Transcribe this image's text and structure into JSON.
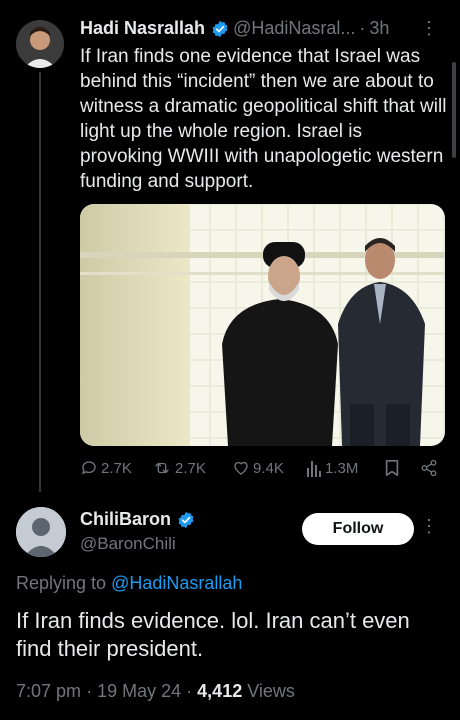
{
  "tweet": {
    "author_name": "Hadi Nasrallah",
    "handle": "@HadiNasral...",
    "separator": "·",
    "time": "3h",
    "text": "If Iran finds one evidence that Israel was behind this “incident” then we are about to witness a dramatic geopolitical shift that will light up the whole region. Israel is provoking WWIII with unapologetic western funding and support.",
    "image_icon": "photo-two-men",
    "actions": {
      "replies": "2.7K",
      "reposts": "2.7K",
      "likes": "9.4K",
      "views": "1.3M"
    }
  },
  "reply": {
    "author_name": "ChiliBaron",
    "handle": "@BaronChili",
    "follow_label": "Follow",
    "replying_prefix": "Replying to ",
    "replying_to": "@HadiNasrallah",
    "text": "If Iran finds evidence. lol. Iran can’t even find their president.",
    "time": "7:07 pm",
    "dot1": "·",
    "date": "19 May 24",
    "dot2": "·",
    "views_count": "4,412",
    "views_label": "Views"
  },
  "colors": {
    "background": "#000000",
    "text": "#e7e9ea",
    "muted": "#71767b",
    "link": "#1d9bf0",
    "verified": "#1d9bf0"
  }
}
